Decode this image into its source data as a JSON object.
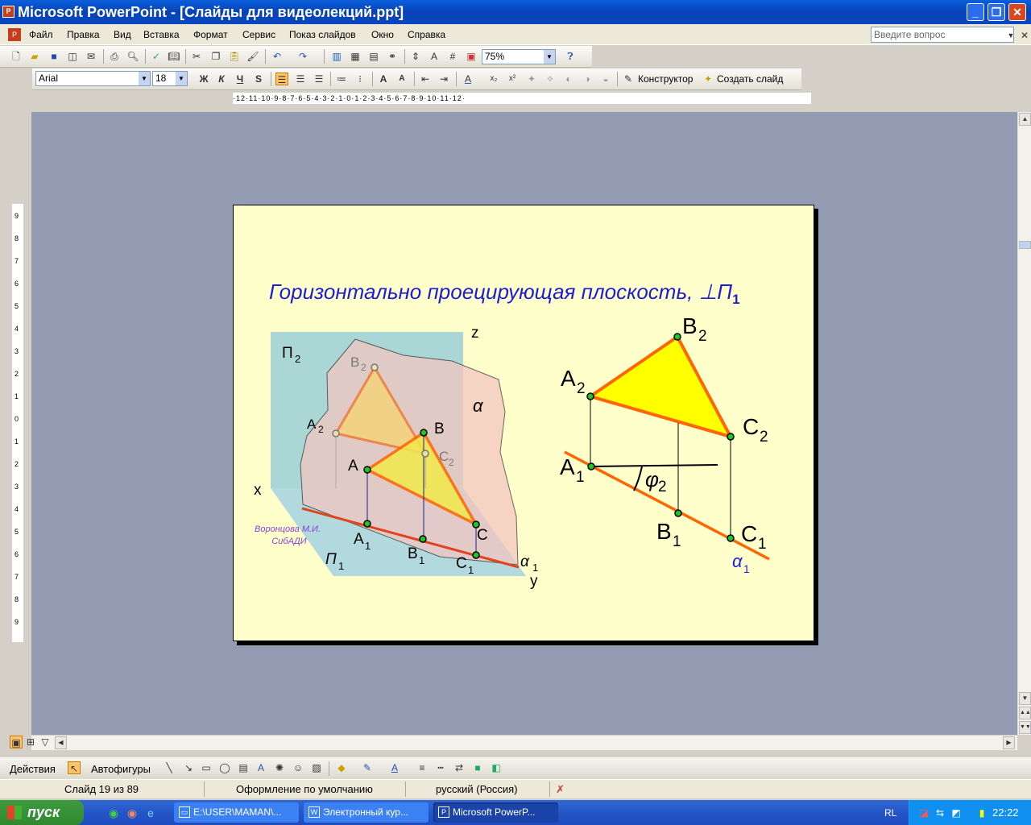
{
  "window": {
    "title": "Microsoft PowerPoint - [Слайды для видеолекций.ppt]",
    "app_icon": "powerpoint-icon"
  },
  "menu": {
    "items": [
      "Файл",
      "Правка",
      "Вид",
      "Вставка",
      "Формат",
      "Сервис",
      "Показ слайдов",
      "Окно",
      "Справка"
    ],
    "help_placeholder": "Введите вопрос"
  },
  "standard_toolbar": {
    "zoom": "75%"
  },
  "format_toolbar": {
    "font": "Arial",
    "size": "18",
    "bold": "Ж",
    "italic": "К",
    "underline": "Ч",
    "shadow": "S",
    "designer": "Конструктор",
    "new_slide": "Создать слайд"
  },
  "ruler": {
    "horizontal": "·12·11·10·9·8·7·6·5·4·3·2·1·0·1·2·3·4·5·6·7·8·9·10·11·12·",
    "vertical": [
      "9",
      "8",
      "7",
      "6",
      "5",
      "4",
      "3",
      "2",
      "1",
      "0",
      "1",
      "2",
      "3",
      "4",
      "5",
      "6",
      "7",
      "8",
      "9"
    ]
  },
  "slide": {
    "title": "Горизонтально проецирующая плоскость, ⊥П",
    "title_sub": "1",
    "left_figure": {
      "labels": {
        "z": "z",
        "x": "x",
        "y": "y",
        "alpha": "α",
        "pi2": "П",
        "pi2_sub": "2",
        "pi1": "П",
        "pi1_sub": "1",
        "A": "A",
        "B": "B",
        "C": "C",
        "A1": "A",
        "B1": "B",
        "C1": "C",
        "A2": "A",
        "B2": "B",
        "C2": "C",
        "alpha1": "α",
        "sub1": "1",
        "sub2": "2"
      },
      "author": "Воронцова М.И.",
      "org": "СибАДИ"
    },
    "right_figure": {
      "labels": {
        "A2": "A",
        "B2": "B",
        "C2": "C",
        "A1": "A",
        "B1": "B",
        "C1": "C",
        "phi": "φ",
        "alpha1": "α",
        "sub1": "1",
        "sub2": "2"
      }
    }
  },
  "drawing_toolbar": {
    "actions": "Действия",
    "autoshapes": "Автофигуры"
  },
  "status": {
    "slide": "Слайд 19 из 89",
    "design": "Оформление по умолчанию",
    "language": "русский (Россия)"
  },
  "taskbar": {
    "start": "пуск",
    "tasks": [
      "E:\\USER\\MAMAN\\...",
      "Электронный кур...",
      "Microsoft PowerP..."
    ],
    "lang": "RL",
    "clock": "22:22"
  },
  "colors": {
    "slide_bg": "#ffffcc",
    "title_blue": "#1d1dd6",
    "triangle_fill": "#ffff00",
    "edge_orange": "#ff6600",
    "point_green": "#00cc00"
  }
}
